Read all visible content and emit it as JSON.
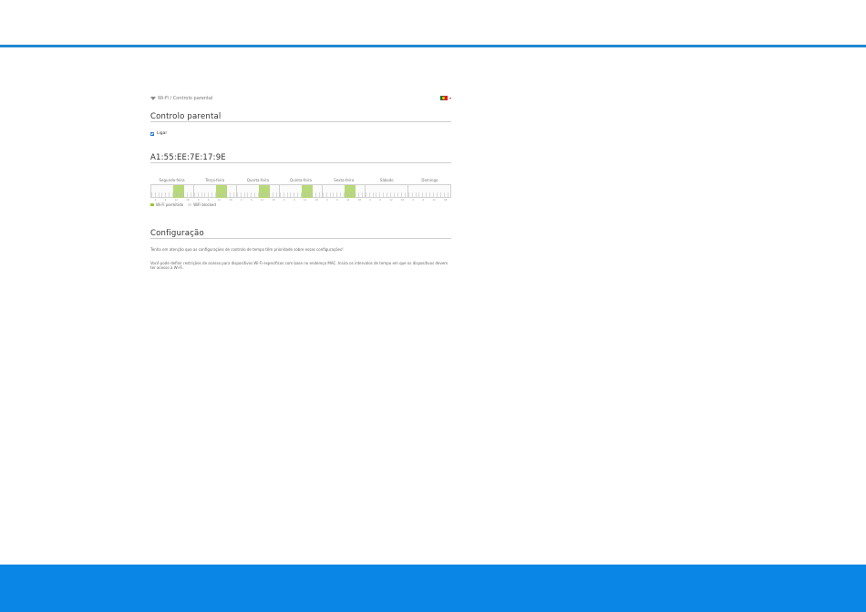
{
  "breadcrumb": {
    "text": "Wi-Fi / Controlo parental"
  },
  "language": {
    "flag": "portugal-flag"
  },
  "parental_control": {
    "title": "Controlo parental",
    "enable_label": "Ligar",
    "enabled": true
  },
  "device": {
    "mac": "A1:55:EE:7E:17:9E"
  },
  "schedule": {
    "days": [
      "Segunda-feira",
      "Terça-feira",
      "Quarta-feira",
      "Quinta-feira",
      "Sexta-feira",
      "Sábado",
      "Domingo"
    ],
    "hour_labels": [
      "0",
      "6",
      "12",
      "18"
    ],
    "allowed_days": [
      "Segunda-feira",
      "Terça-feira",
      "Quarta-feira",
      "Quinta-feira",
      "Sexta-feira"
    ]
  },
  "legend": {
    "allowed": "Wi-Fi permitido",
    "blocked": "WiFi blocked"
  },
  "configuration": {
    "title": "Configuração",
    "text1": "Tenha em atenção que as configurações de controlo de tempo têm prioridade sobre essas configurações!",
    "text2": "Você pode definir restrições de acesso para dispositivos Wi-Fi específicos com base no endereço MAC. Insira os intervalos de tempo em que os dispositivos devem ter acesso à Wi-Fi."
  },
  "colors": {
    "accent": "#1e88d2",
    "footer": "#0a86e6",
    "allowed": "#b7d97a",
    "checkbox": "#1e6fd0"
  }
}
